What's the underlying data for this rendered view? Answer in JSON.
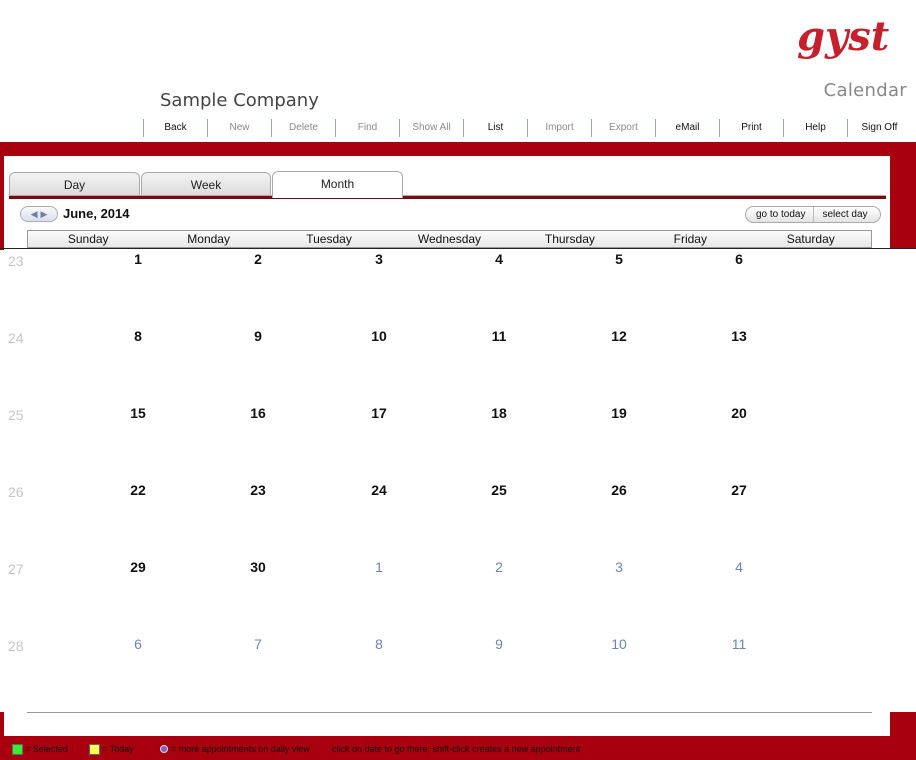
{
  "header": {
    "logo_text": "gyst",
    "app_name": "Calendar",
    "company_name": "Sample Company"
  },
  "toolbar": [
    {
      "label": "Back",
      "enabled": true
    },
    {
      "label": "New",
      "enabled": false
    },
    {
      "label": "Delete",
      "enabled": false
    },
    {
      "label": "Find",
      "enabled": false
    },
    {
      "label": "Show All",
      "enabled": false
    },
    {
      "label": "List",
      "enabled": true
    },
    {
      "label": "Import",
      "enabled": false
    },
    {
      "label": "Export",
      "enabled": false
    },
    {
      "label": "eMail",
      "enabled": true
    },
    {
      "label": "Print",
      "enabled": true
    },
    {
      "label": "Help",
      "enabled": true
    },
    {
      "label": "Sign Off",
      "enabled": true
    }
  ],
  "tabs": [
    {
      "label": "Day",
      "active": false
    },
    {
      "label": "Week",
      "active": false
    },
    {
      "label": "Month",
      "active": true
    }
  ],
  "nav": {
    "month_label": "June, 2014",
    "go_to_today": "go to today",
    "select_day": "select day"
  },
  "weekdays": [
    "Sunday",
    "Monday",
    "Tuesday",
    "Wednesday",
    "Thursday",
    "Friday",
    "Saturday"
  ],
  "weeks": [
    {
      "num": "23",
      "days": [
        {
          "d": "1",
          "cur": true
        },
        {
          "d": "2",
          "cur": true
        },
        {
          "d": "3",
          "cur": true
        },
        {
          "d": "4",
          "cur": true
        },
        {
          "d": "5",
          "cur": true
        },
        {
          "d": "6",
          "cur": true
        }
      ]
    },
    {
      "num": "24",
      "days": [
        {
          "d": "8",
          "cur": true
        },
        {
          "d": "9",
          "cur": true
        },
        {
          "d": "10",
          "cur": true
        },
        {
          "d": "11",
          "cur": true
        },
        {
          "d": "12",
          "cur": true
        },
        {
          "d": "13",
          "cur": true
        }
      ]
    },
    {
      "num": "25",
      "days": [
        {
          "d": "15",
          "cur": true
        },
        {
          "d": "16",
          "cur": true
        },
        {
          "d": "17",
          "cur": true
        },
        {
          "d": "18",
          "cur": true
        },
        {
          "d": "19",
          "cur": true
        },
        {
          "d": "20",
          "cur": true
        }
      ]
    },
    {
      "num": "26",
      "days": [
        {
          "d": "22",
          "cur": true
        },
        {
          "d": "23",
          "cur": true
        },
        {
          "d": "24",
          "cur": true
        },
        {
          "d": "25",
          "cur": true
        },
        {
          "d": "26",
          "cur": true
        },
        {
          "d": "27",
          "cur": true
        }
      ]
    },
    {
      "num": "27",
      "days": [
        {
          "d": "29",
          "cur": true
        },
        {
          "d": "30",
          "cur": true
        },
        {
          "d": "1",
          "cur": false
        },
        {
          "d": "2",
          "cur": false
        },
        {
          "d": "3",
          "cur": false
        },
        {
          "d": "4",
          "cur": false
        }
      ]
    },
    {
      "num": "28",
      "days": [
        {
          "d": "6",
          "cur": false
        },
        {
          "d": "7",
          "cur": false
        },
        {
          "d": "8",
          "cur": false
        },
        {
          "d": "9",
          "cur": false
        },
        {
          "d": "10",
          "cur": false
        },
        {
          "d": "11",
          "cur": false
        }
      ]
    }
  ],
  "legend": {
    "selected": "= Selected",
    "today": "= Today",
    "more": "= more appointments on daily view",
    "hint": "click on date to go there; shift-click creates a new appointment"
  },
  "colors": {
    "brand_red": "#a8000f",
    "selected_swatch": "#33ee33",
    "today_swatch": "#ffff55",
    "other_month_day": "#6c84b4"
  }
}
